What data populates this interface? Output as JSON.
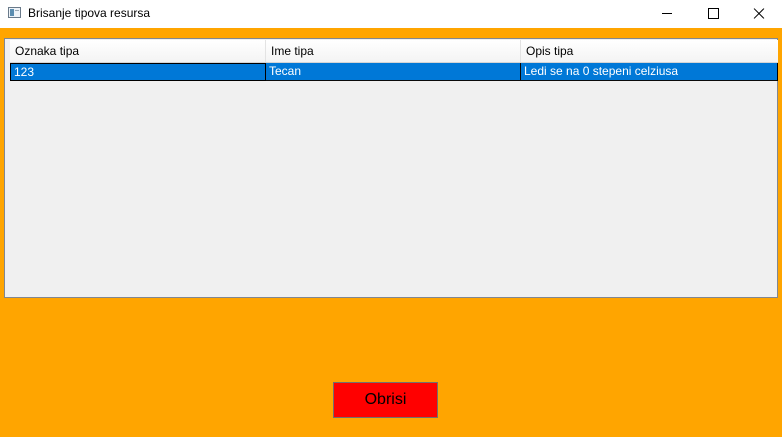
{
  "window": {
    "title": "Brisanje tipova resursa",
    "icon": "app-window-icon",
    "controls": {
      "minimize_icon": "minimize-icon",
      "maximize_icon": "maximize-icon",
      "close_icon": "close-icon"
    }
  },
  "colors": {
    "background": "#ffa500",
    "selection": "#0078d7",
    "delete_button": "#ff0000"
  },
  "grid": {
    "columns": [
      "Oznaka tipa",
      "Ime tipa",
      "Opis tipa"
    ],
    "rows": [
      {
        "selected": true,
        "cells": [
          "123",
          "Tecan",
          "Ledi se na 0 stepeni celziusa"
        ]
      }
    ]
  },
  "actions": {
    "delete_label": "Obrisi"
  }
}
